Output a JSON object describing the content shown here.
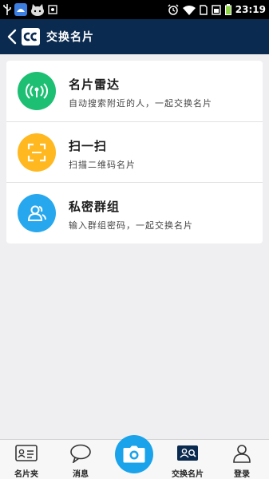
{
  "status_bar": {
    "time": "23:19",
    "icons": [
      "usb-icon",
      "notification-app-icon",
      "cat-app-icon",
      "screenshot-icon",
      "alarm-icon",
      "wifi-icon",
      "sim-icon",
      "signal-icon",
      "battery-icon"
    ]
  },
  "header": {
    "title": "交换名片",
    "logo_text": "CC"
  },
  "menu": {
    "items": [
      {
        "title": "名片雷达",
        "subtitle": "自动搜索附近的人，一起交换名片",
        "icon": "radar-icon",
        "color": "#1dbf73"
      },
      {
        "title": "扫一扫",
        "subtitle": "扫描二维码名片",
        "icon": "scan-icon",
        "color": "#ffb81f"
      },
      {
        "title": "私密群组",
        "subtitle": "输入群组密码，一起交换名片",
        "icon": "group-icon",
        "color": "#27a8ee"
      }
    ]
  },
  "bottom_nav": {
    "items": [
      {
        "label": "名片夹",
        "icon": "card-holder-icon"
      },
      {
        "label": "消息",
        "icon": "message-icon"
      },
      {
        "label": "交换名片",
        "icon": "exchange-card-icon",
        "active": true
      },
      {
        "label": "登录",
        "icon": "user-icon"
      }
    ],
    "camera_icon": "camera-icon",
    "camera_color": "#1aa3ea"
  }
}
